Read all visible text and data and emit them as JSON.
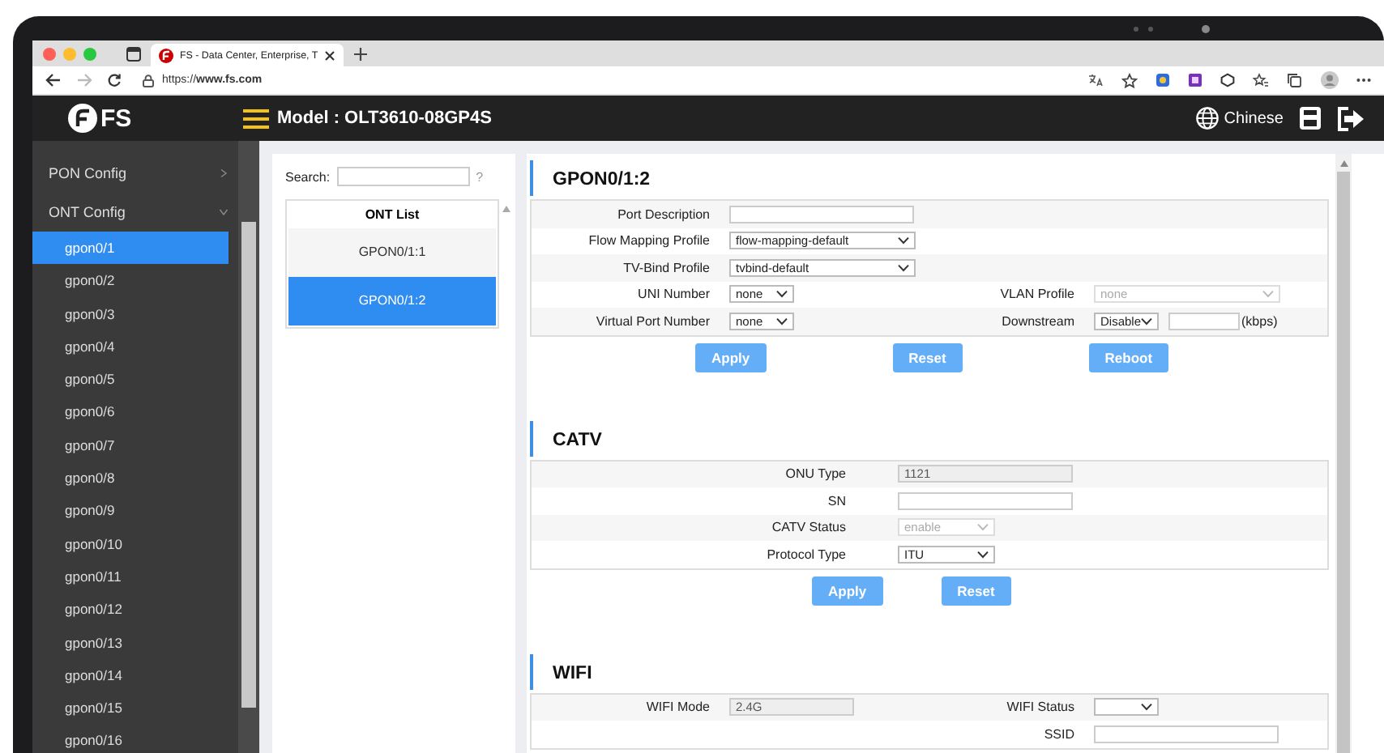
{
  "browser": {
    "tab_title": "FS - Data Center, Enterprise, T",
    "url": "https://**www.fs.com**"
  },
  "header": {
    "logo": "FS",
    "model": "Model : OLT3610-08GP4S",
    "language": "Chinese"
  },
  "sidebar": {
    "items": [
      {
        "label": "PON Config",
        "expanded": false
      },
      {
        "label": "ONT Config",
        "expanded": true,
        "children": [
          {
            "label": "gpon0/1",
            "selected": true
          },
          {
            "label": "gpon0/2",
            "selected": false
          },
          {
            "label": "gpon0/3",
            "selected": false
          },
          {
            "label": "gpon0/4",
            "selected": false
          },
          {
            "label": "gpon0/5",
            "selected": false
          },
          {
            "label": "gpon0/6",
            "selected": false
          },
          {
            "label": "gpon0/7",
            "selected": false
          },
          {
            "label": "gpon0/8",
            "selected": false
          },
          {
            "label": "gpon0/9",
            "selected": false
          },
          {
            "label": "gpon0/10",
            "selected": false
          },
          {
            "label": "gpon0/11",
            "selected": false
          },
          {
            "label": "gpon0/12",
            "selected": false
          },
          {
            "label": "gpon0/13",
            "selected": false
          },
          {
            "label": "gpon0/14",
            "selected": false
          },
          {
            "label": "gpon0/15",
            "selected": false
          },
          {
            "label": "gpon0/16",
            "selected": false
          }
        ]
      }
    ]
  },
  "search": {
    "label": "Search:",
    "help": "?"
  },
  "ont_list": {
    "title": "ONT List",
    "items": [
      {
        "label": "GPON0/1:1",
        "selected": false
      },
      {
        "label": "GPON0/1:2",
        "selected": true
      }
    ]
  },
  "sections": [
    {
      "title": "GPON0/1:2",
      "rows": [
        [
          {
            "label": "Port Description",
            "kind": "input"
          }
        ],
        [
          {
            "label": "Flow Mapping Profile",
            "kind": "select",
            "value": "flow-mapping-default"
          }
        ],
        [
          {
            "label": "TV-Bind Profile",
            "kind": "select",
            "value": "tvbind-default"
          }
        ],
        [
          {
            "label": "UNI Number",
            "kind": "short-select",
            "value": "none"
          },
          {
            "label": "VLAN Profile",
            "kind": "select",
            "value": "none",
            "disabled": true
          }
        ],
        [
          {
            "label": "Virtual Port Number",
            "kind": "short-select",
            "value": "none"
          },
          {
            "label": "Downstream",
            "kind": "select-with-input",
            "value": "Disable",
            "unit": "(kbps)"
          }
        ]
      ],
      "buttons": [
        "Apply",
        "Reset",
        "Reboot"
      ]
    },
    {
      "title": "CATV",
      "rows": [
        [
          {
            "label": "ONU Type",
            "kind": "readonly",
            "value": "1121"
          }
        ],
        [
          {
            "label": "SN",
            "kind": "input"
          }
        ],
        [
          {
            "label": "CATV Status",
            "kind": "short-select",
            "value": "enable",
            "disabled": true
          }
        ],
        [
          {
            "label": "Protocol Type",
            "kind": "short-select",
            "value": "ITU"
          }
        ]
      ],
      "buttons": [
        "Apply",
        "Reset"
      ]
    },
    {
      "title": "WIFI",
      "rows": [
        [
          {
            "label": "WIFI Mode",
            "kind": "readonly",
            "value": "2.4G"
          },
          {
            "label": "WIFI Status",
            "kind": "short-select"
          }
        ],
        [
          {
            "kind": "empty"
          },
          {
            "label": "SSID",
            "kind": "input"
          }
        ]
      ]
    }
  ]
}
